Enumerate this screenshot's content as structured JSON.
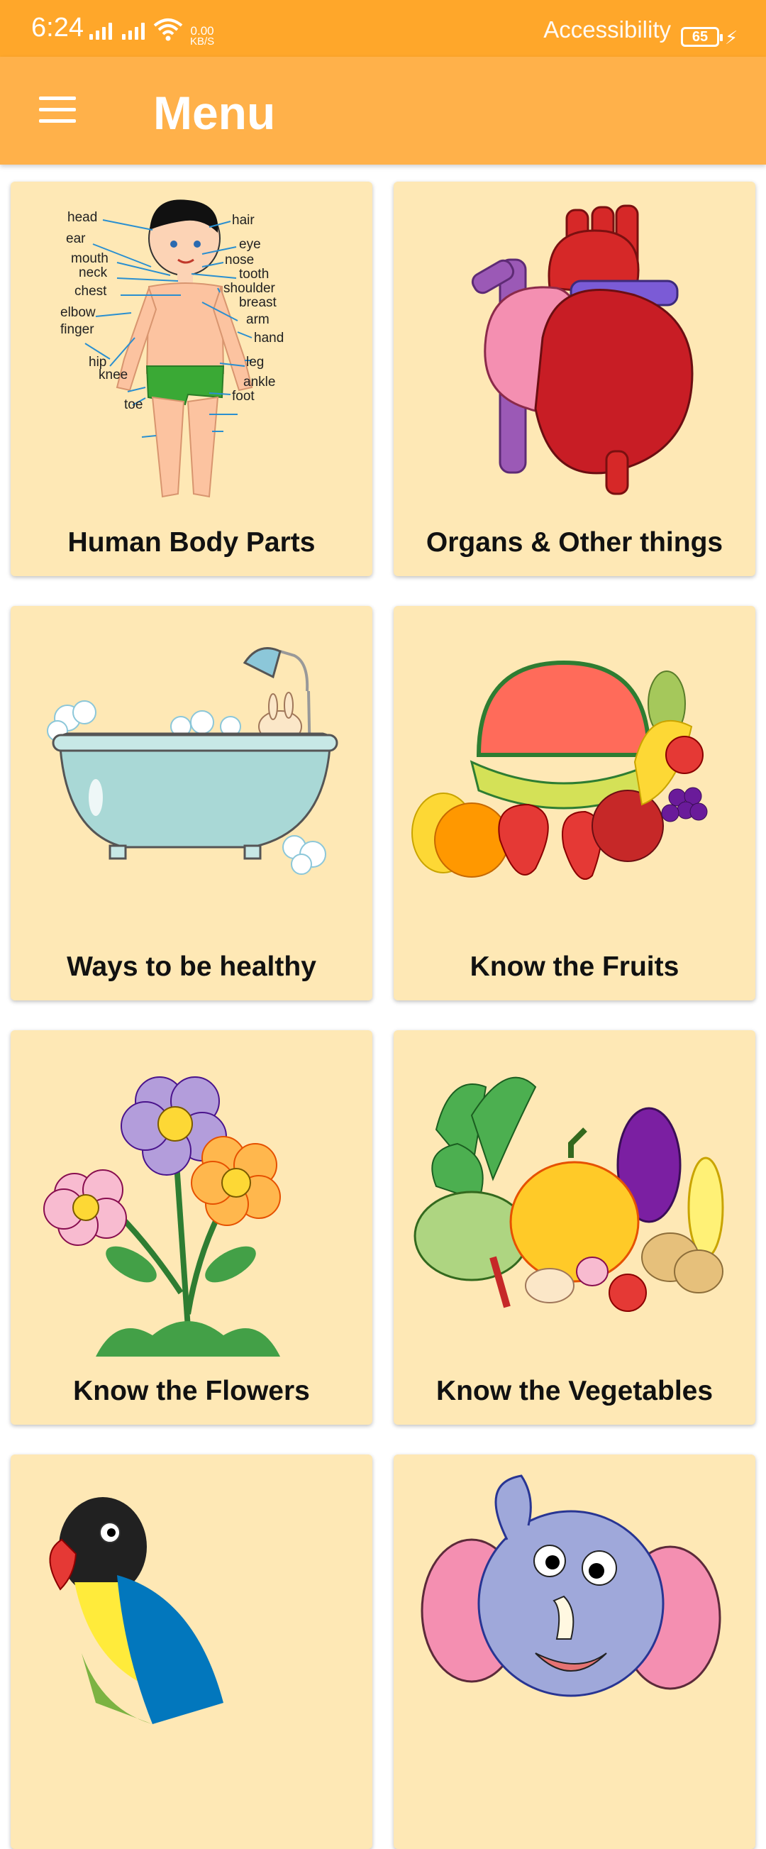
{
  "status_bar": {
    "time": "6:24",
    "net_speed_value": "0.00",
    "net_speed_unit": "KB/S",
    "accessibility_label": "Accessibility",
    "battery_level": "65"
  },
  "app_bar": {
    "title": "Menu",
    "menu_icon": "hamburger-menu-icon",
    "color": "#FFB14A"
  },
  "theme": {
    "status_bar_color": "#FFA72A",
    "card_color": "#FEE8B5"
  },
  "cards": [
    {
      "label": "Human Body Parts",
      "icon": "human-body-illustration"
    },
    {
      "label": "Organs & Other things",
      "icon": "heart-illustration"
    },
    {
      "label": "Ways to be healthy",
      "icon": "bathtub-illustration"
    },
    {
      "label": "Know the Fruits",
      "icon": "fruits-illustration"
    },
    {
      "label": "Know the Flowers",
      "icon": "flowers-illustration"
    },
    {
      "label": "Know the Vegetables",
      "icon": "vegetables-illustration"
    },
    {
      "label": "",
      "icon": "parrot-illustration"
    },
    {
      "label": "",
      "icon": "elephant-illustration"
    }
  ],
  "body_labels": {
    "head": "head",
    "hair": "hair",
    "ear": "ear",
    "eye": "eye",
    "mouth": "mouth",
    "nose": "nose",
    "neck": "neck",
    "tooth": "tooth",
    "chest": "chest",
    "shoulder": "shoulder",
    "breast": "breast",
    "elbow": "elbow",
    "arm": "arm",
    "finger": "finger",
    "hand": "hand",
    "hip": "hip",
    "leg": "leg",
    "knee": "knee",
    "ankle": "ankle",
    "foot": "foot",
    "toe": "toe"
  }
}
